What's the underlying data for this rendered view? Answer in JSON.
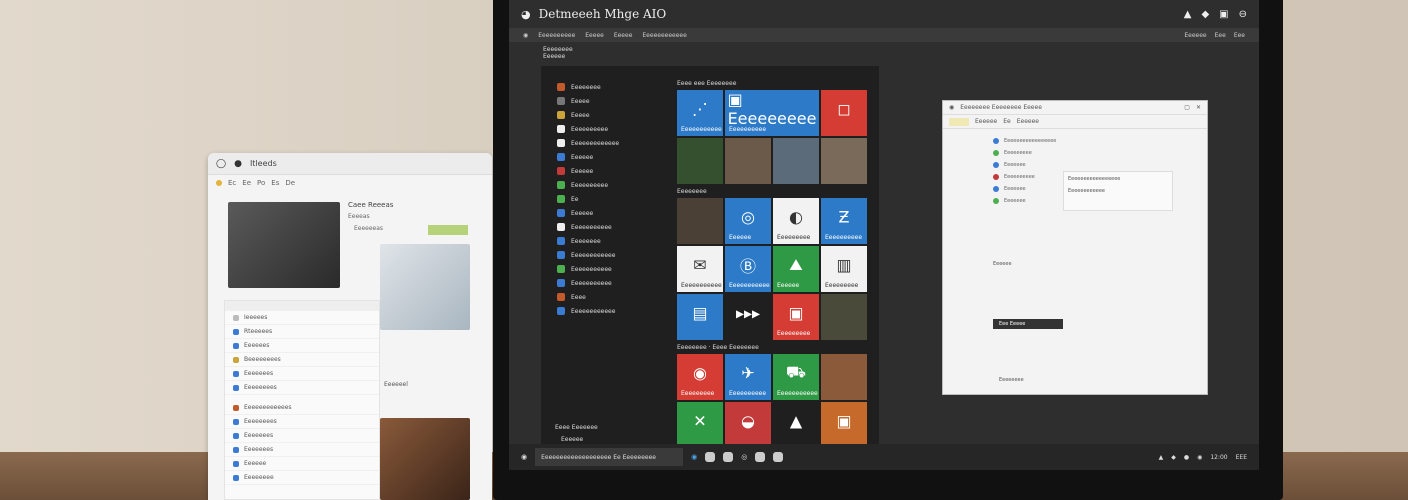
{
  "left_window": {
    "title": "Itleeds",
    "menu": [
      "Ec",
      "Ee",
      "Po",
      "Es",
      "De"
    ],
    "card_title": "Caee Reeeas",
    "card_sub": "Eeeeas",
    "card_sub2": "Eeeeeeas",
    "list": [
      {
        "label": "Ieeeees",
        "color": "#bbb"
      },
      {
        "label": "Rteeeees",
        "color": "#3b7bd3"
      },
      {
        "label": "Eeeeees",
        "color": "#3b7bd3"
      },
      {
        "label": "Beeeeeeees",
        "color": "#c9a53a"
      },
      {
        "label": "Eeeeeees",
        "color": "#3b7bd3"
      },
      {
        "label": "Eeeeeeees",
        "color": "#3b7bd3"
      }
    ],
    "list2": [
      {
        "label": "Eeeeeeeeeeees",
        "color": "#c25a2b"
      },
      {
        "label": "Eeeeeeees",
        "color": "#3b7bd3"
      },
      {
        "label": "Eeeeeees",
        "color": "#3b7bd3"
      },
      {
        "label": "Eeeeeees",
        "color": "#3b7bd3"
      },
      {
        "label": "Eeeeee",
        "color": "#3b7bd3"
      },
      {
        "label": "Eeeeeeee",
        "color": "#3b7bd3"
      }
    ],
    "side_label": "Eeeeeel"
  },
  "topbar": {
    "title": "Detmeeeh Mhge AIO",
    "icons": [
      "warning-icon",
      "shield-icon",
      "app-icon",
      "settings-icon"
    ]
  },
  "menubar": {
    "items": [
      "Eeeeeeeeee",
      "Eeeee",
      "Eeeee",
      "Eeeeeeeeeeee"
    ],
    "right": [
      "Eeeeee",
      "Eee",
      "Eee"
    ]
  },
  "start_header": {
    "line1": "Eeeeeeee",
    "line2": "Eeeeee"
  },
  "apps": [
    {
      "label": "Eeeeeeee",
      "color": "#c25a2b"
    },
    {
      "label": "Eeeee",
      "color": "#777"
    },
    {
      "label": "Eeeee",
      "color": "#c9a53a"
    },
    {
      "label": "Eeeeeeeeee",
      "color": "#eee"
    },
    {
      "label": "Eeeeeeeeeeeee",
      "color": "#eee"
    },
    {
      "label": "Eeeeee",
      "color": "#3b7bd3"
    },
    {
      "label": "Eeeeee",
      "color": "#c23a3a"
    },
    {
      "label": "Eeeeeeeeee",
      "color": "#4caf50"
    },
    {
      "label": "Ee",
      "color": "#4caf50"
    },
    {
      "label": "Eeeeee",
      "color": "#3b7bd3"
    },
    {
      "label": "Eeeeeeeeeee",
      "color": "#eee"
    },
    {
      "label": "Eeeeeeee",
      "color": "#3b7bd3"
    },
    {
      "label": "Eeeeeeeeeeee",
      "color": "#3b7bd3"
    },
    {
      "label": "Eeeeeeeeeee",
      "color": "#4caf50"
    },
    {
      "label": "Eeeeeeeeeee",
      "color": "#3b7bd3"
    },
    {
      "label": "Eeee",
      "color": "#c25a2b"
    },
    {
      "label": "Eeeeeeeeeeee",
      "color": "#3b7bd3"
    }
  ],
  "tiles": {
    "section1": "Eeee eee Eeeeeeee",
    "section2": "Eeeeeeee",
    "section3": "Eeeeeeee · Eeee Eeeeeeee",
    "row1": [
      {
        "label": "Eeeeeeeeeee",
        "color": "#2d7bc8",
        "glyph": "⋰"
      },
      {
        "label": "Eeeeeeeeee",
        "color": "#2d7bc8",
        "glyph": "▣ Eeeeeeeee",
        "wide": true
      },
      {
        "label": "",
        "color": "#d43c34",
        "glyph": "◻"
      }
    ],
    "row2": [
      {
        "label": "",
        "color": "#35502f",
        "glyph": ""
      },
      {
        "label": "",
        "color": "#6b5a4a",
        "glyph": ""
      },
      {
        "label": "",
        "color": "#5b6b7a",
        "glyph": ""
      },
      {
        "label": "",
        "color": "#7a6a5a",
        "glyph": ""
      }
    ],
    "row3": [
      {
        "label": "",
        "color": "#4a4036",
        "glyph": ""
      },
      {
        "label": "Eeeeee",
        "color": "#2d7bc8",
        "glyph": "◎"
      },
      {
        "label": "Eeeeeeeee",
        "color": "#f2f2f2",
        "glyph": "◐"
      },
      {
        "label": "Eeeeeeeeee",
        "color": "#2d7bc8",
        "glyph": "Ƶ"
      }
    ],
    "row4": [
      {
        "label": "Eeeeeeeeeee",
        "color": "#f2f2f2",
        "glyph": "✉"
      },
      {
        "label": "Eeeeeeeeeee",
        "color": "#2d7bc8",
        "glyph": "Ⓑ"
      },
      {
        "label": "Eeeeee",
        "color": "#2f9a45",
        "glyph": "⛰"
      },
      {
        "label": "Eeeeeeeee",
        "color": "#f2f2f2",
        "glyph": "▥"
      }
    ],
    "row5": [
      {
        "label": "",
        "color": "#2d7bc8",
        "glyph": "▤"
      },
      {
        "label": "",
        "color": "#1f1f1f",
        "glyph": "▸▸▸"
      },
      {
        "label": "Eeeeeeeee",
        "color": "#d43c34",
        "glyph": "▣"
      },
      {
        "label": "",
        "color": "#4a4a3a",
        "glyph": ""
      }
    ],
    "row6": [
      {
        "label": "Eeeeeeeee",
        "color": "#d43c34",
        "glyph": "◉"
      },
      {
        "label": "Eeeeeeeeee",
        "color": "#2d7bc8",
        "glyph": "✈"
      },
      {
        "label": "Eeeeeeeeeee",
        "color": "#2f9a45",
        "glyph": "⛟"
      },
      {
        "label": "",
        "color": "#8a5a3a",
        "glyph": ""
      }
    ],
    "row7": [
      {
        "label": "",
        "color": "#2f9a45",
        "glyph": "✕"
      },
      {
        "label": "",
        "color": "#c23a3a",
        "glyph": "◒"
      },
      {
        "label": "",
        "color": "#1f1f1f",
        "glyph": "▲"
      },
      {
        "label": "",
        "color": "#c56a2a",
        "glyph": "▣"
      }
    ]
  },
  "start_footer": {
    "label": "Eeee Eeeeeee",
    "user": "Eeeeee"
  },
  "right_window": {
    "title": "Eeeeeeee Eeeeeeee Eeeee",
    "toolbar": [
      "Eeeeee",
      "Ee",
      "Eeeeee"
    ],
    "rows": [
      {
        "label": "Eeeeeeeeeeeeeeeee",
        "color": "#3b7bd3"
      },
      {
        "label": "Eeeeeeeee",
        "color": "#4caf50"
      },
      {
        "label": "Eeeeeee",
        "color": "#3b7bd3"
      },
      {
        "label": "Eeeeeeeeee",
        "color": "#c23a3a"
      },
      {
        "label": "Eeeeeee",
        "color": "#3b7bd3"
      },
      {
        "label": "Eeeeeee",
        "color": "#4caf50"
      }
    ],
    "detail1": "Eeeeeeeeeeeeeeeee",
    "detail2": "Eeeeeeeeeeee",
    "section": "Eeeeee",
    "active": "Eee Eeeee",
    "foot": "Eeeeeeee"
  },
  "taskbar": {
    "search": "Eeeeeeeeeeeeeeeeeee Ee Eeeeeeeee",
    "apps": [
      "edge-icon",
      "store-icon",
      "files-icon",
      "media-icon",
      "photos-icon",
      "mail-icon"
    ],
    "tray": [
      "▲",
      "◆",
      "●",
      "◉",
      "12:00",
      "EEE"
    ]
  }
}
